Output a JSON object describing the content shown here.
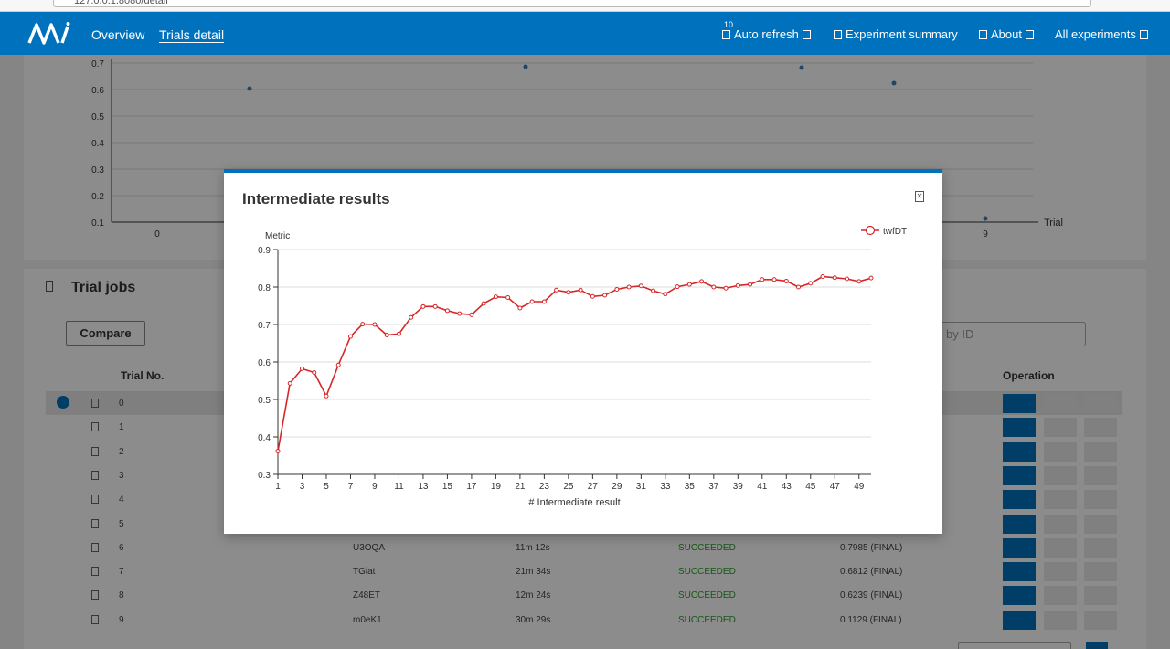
{
  "browser": {
    "url": "127.0.0.1:8080/detail"
  },
  "nav": {
    "overview": "Overview",
    "trials_detail": "Trials detail",
    "auto_refresh_count": "10",
    "auto_refresh": "Auto refresh",
    "experiment_summary": "Experiment summary",
    "about": "About",
    "all_experiments": "All experiments"
  },
  "top_chart": {
    "y_ticks": [
      "0.7",
      "0.6",
      "0.5",
      "0.4",
      "0.3",
      "0.2",
      "0.1"
    ],
    "x_ticks": [
      "0",
      "9"
    ],
    "x_label": "Trial"
  },
  "trial_jobs": {
    "title": "Trial jobs",
    "compare": "Compare",
    "search_placeholder": "by ID",
    "col_trial_no": "Trial No.",
    "col_operation": "Operation",
    "rows": [
      {
        "num": "0",
        "id": "",
        "duration": "",
        "status": "",
        "result": ""
      },
      {
        "num": "1",
        "id": "",
        "duration": "",
        "status": "",
        "result": ""
      },
      {
        "num": "2",
        "id": "",
        "duration": "",
        "status": "",
        "result": ""
      },
      {
        "num": "3",
        "id": "",
        "duration": "",
        "status": "",
        "result": ""
      },
      {
        "num": "4",
        "id": "",
        "duration": "",
        "status": "",
        "result": ""
      },
      {
        "num": "5",
        "id": "",
        "duration": "",
        "status": "",
        "result": ""
      },
      {
        "num": "6",
        "id": "U3OQA",
        "duration": "11m 12s",
        "status": "SUCCEEDED",
        "result": "0.7985 (FINAL)"
      },
      {
        "num": "7",
        "id": "TGiat",
        "duration": "21m 34s",
        "status": "SUCCEEDED",
        "result": "0.6812 (FINAL)"
      },
      {
        "num": "8",
        "id": "Z48ET",
        "duration": "12m 24s",
        "status": "SUCCEEDED",
        "result": "0.6239 (FINAL)"
      },
      {
        "num": "9",
        "id": "m0eK1",
        "duration": "30m 29s",
        "status": "SUCCEEDED",
        "result": "0.1129 (FINAL)"
      }
    ]
  },
  "modal": {
    "title": "Intermediate results"
  },
  "chart_data": {
    "type": "line",
    "ylabel": "Metric",
    "xlabel": "# Intermediate result",
    "ylim": [
      0.3,
      0.9
    ],
    "yticks": [
      0.3,
      0.4,
      0.5,
      0.6,
      0.7,
      0.8,
      0.9
    ],
    "xticks": [
      1,
      3,
      5,
      7,
      9,
      11,
      13,
      15,
      17,
      19,
      21,
      23,
      25,
      27,
      29,
      31,
      33,
      35,
      37,
      39,
      41,
      43,
      45,
      47,
      49
    ],
    "legend_position": "top-right",
    "color": "#d62728",
    "series": [
      {
        "name": "twfDT",
        "x": [
          1,
          2,
          3,
          4,
          5,
          6,
          7,
          8,
          9,
          10,
          11,
          12,
          13,
          14,
          15,
          16,
          17,
          18,
          19,
          20,
          21,
          22,
          23,
          24,
          25,
          26,
          27,
          28,
          29,
          30,
          31,
          32,
          33,
          34,
          35,
          36,
          37,
          38,
          39,
          40,
          41,
          42,
          43,
          44,
          45,
          46,
          47,
          48,
          49,
          50
        ],
        "values": [
          0.362,
          0.543,
          0.582,
          0.572,
          0.509,
          0.592,
          0.668,
          0.701,
          0.7,
          0.672,
          0.675,
          0.719,
          0.748,
          0.748,
          0.737,
          0.729,
          0.726,
          0.756,
          0.774,
          0.772,
          0.744,
          0.761,
          0.761,
          0.792,
          0.786,
          0.792,
          0.775,
          0.778,
          0.794,
          0.8,
          0.803,
          0.79,
          0.781,
          0.801,
          0.807,
          0.815,
          0.8,
          0.797,
          0.804,
          0.807,
          0.82,
          0.82,
          0.816,
          0.8,
          0.81,
          0.828,
          0.825,
          0.822,
          0.815,
          0.824
        ]
      }
    ]
  }
}
